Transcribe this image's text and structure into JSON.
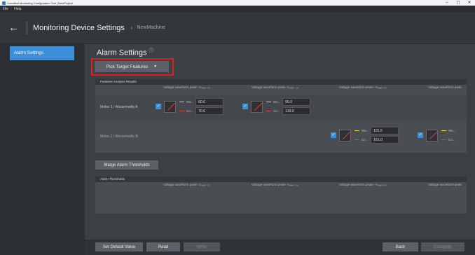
{
  "window": {
    "title": "Condition Monitoring Configuration Tool | NewProject",
    "min": "–",
    "max": "◻",
    "close": "✕"
  },
  "menu": [
    "File",
    "Help"
  ],
  "header": {
    "back_icon": "←",
    "title": "Monitoring Device Settings",
    "crumb_arrow": "›",
    "crumb": "NewMachine"
  },
  "sidebar": {
    "items": [
      {
        "label": "Alarm Settings"
      }
    ]
  },
  "main": {
    "title": "Alarm Settings",
    "info_icon": "ⓘ",
    "pick_button": "Pick Target Features",
    "pick_caret": "▼",
    "features": {
      "title": "Features Analysis Results",
      "columns": [
        "Voltage waveform peak- Vₚₑₐₖ₋₃₁",
        "Voltage waveform peak- Vₚₑₐₖ₋₁₉",
        "Voltage waveform peak+ Vₚₑₐₖ₊₂₀",
        "Voltage waveform peak"
      ],
      "rows": [
        {
          "label": "Motor 1 / Abnormality A",
          "cells": [
            {
              "warn_label": "Wa...",
              "warn": "60.0",
              "crit_label": "Cri...",
              "crit": "70.0"
            },
            {
              "warn_label": "Wa...",
              "warn": "95.0",
              "crit_label": "Cri...",
              "crit": "133.0"
            }
          ]
        },
        {
          "label": "Motor 2 / Abnormality B",
          "cells": [
            {
              "warn_label": "Wa...",
              "warn": "115.0",
              "crit_label": "Cri...",
              "crit": "161.0"
            },
            {
              "warn_label": "Wa...",
              "crit_label": "Cri..."
            }
          ]
        }
      ]
    },
    "merge_button": "Marge Alarm Thresholds",
    "thresholds": {
      "title": "Alarm Thresholds",
      "columns": [
        "Voltage waveform peak- Vₚₑₐₖ₋₃₁",
        "Voltage waveform peak- Vₚₑₐₖ₋₁₉",
        "Voltage waveform peak+ Vₚₑₐₖ₊₂₀",
        "Voltage waveform peak"
      ]
    },
    "footer": {
      "set_default": "Set Default Value",
      "read": "Read",
      "write": "Write",
      "back": "Back",
      "complete": "Complete"
    }
  },
  "colors": {
    "accent": "#3a8fd8",
    "warning": "#e8d44a",
    "critical": "#e04040",
    "highlight": "#e02020"
  }
}
